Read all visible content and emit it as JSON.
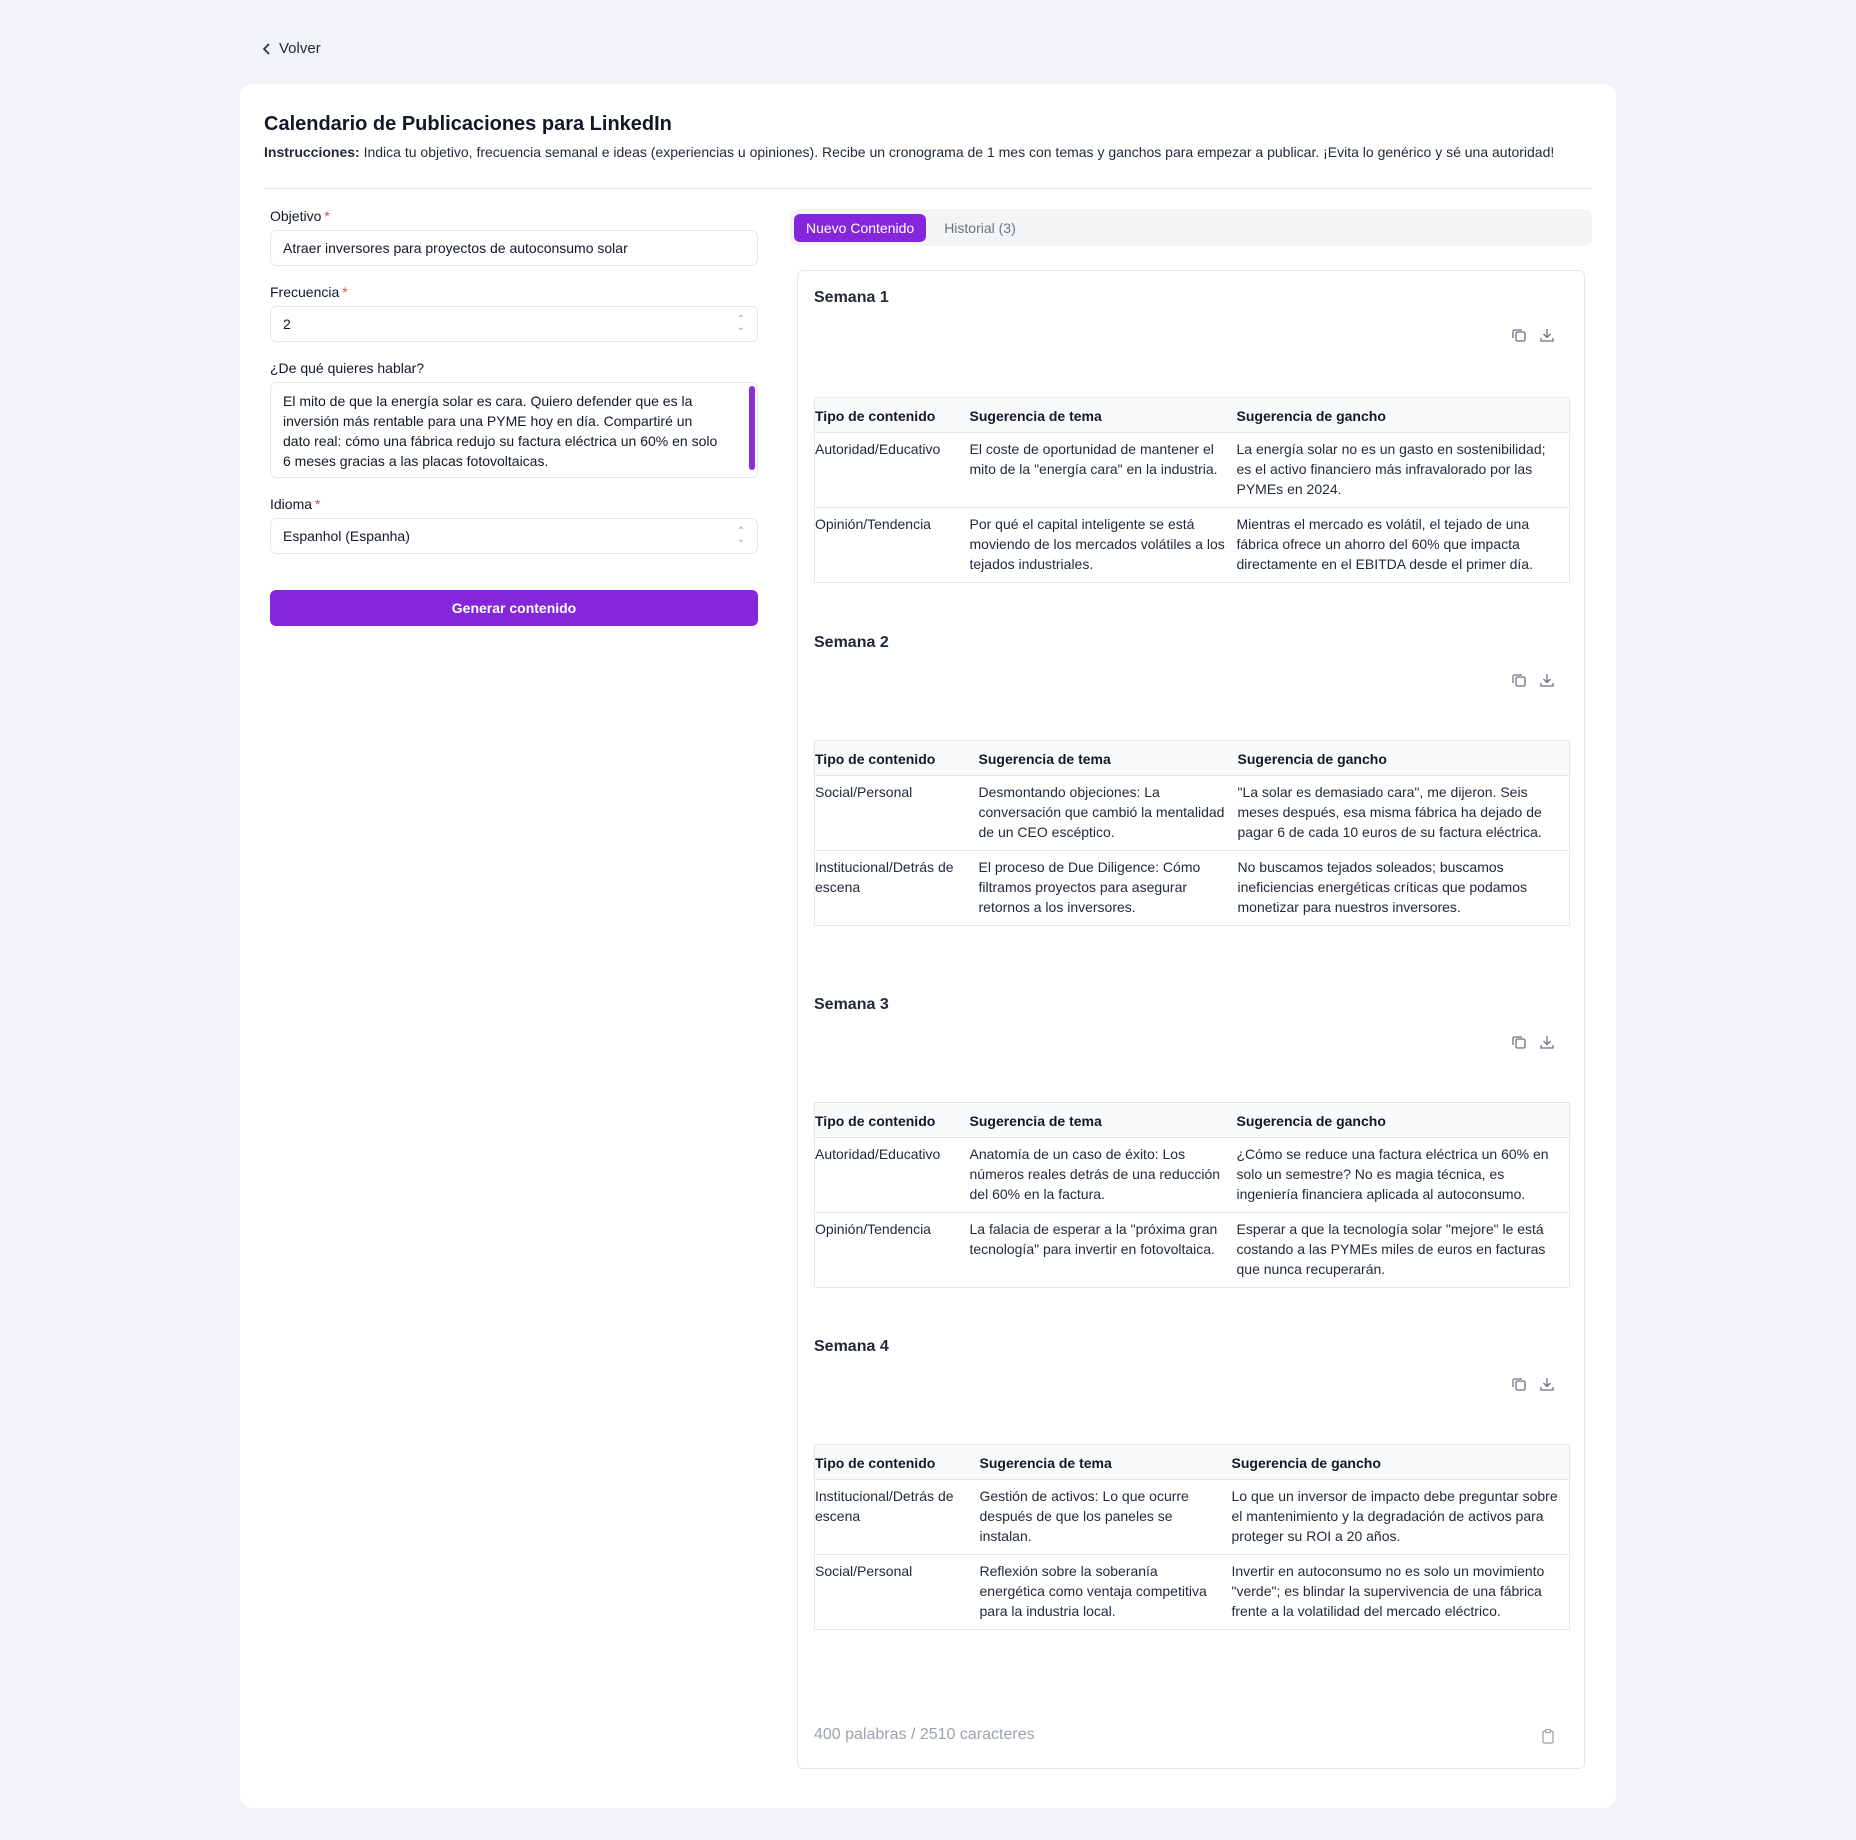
{
  "nav": {
    "back_label": "Volver"
  },
  "page": {
    "title": "Calendario de Publicaciones para LinkedIn",
    "instructions_label": "Instrucciones:",
    "instructions_text": " Indica tu objetivo, frecuencia semanal e ideas (experiencias u opiniones). Recibe un cronograma de 1 mes con temas y ganchos para empezar a publicar. ¡Evita lo genérico y sé una autoridad!"
  },
  "form": {
    "objetivo_label": "Objetivo",
    "objetivo_value": "Atraer inversores para proyectos de autoconsumo solar",
    "frecuencia_label": "Frecuencia",
    "frecuencia_value": "2",
    "tema_label": "¿De qué quieres hablar?",
    "tema_value": "El mito de que la energía solar es cara. Quiero defender que es la inversión más rentable para una PYME hoy en día. Compartiré un dato real: cómo una fábrica redujo su factura eléctrica un 60% en solo 6 meses gracias a las placas fotovoltaicas.",
    "idioma_label": "Idioma",
    "idioma_value": "Espanhol (Espanha)",
    "required_mark": "*",
    "generate_label": "Generar contenido"
  },
  "tabs": [
    {
      "label": "Nuevo Contenido",
      "active": true
    },
    {
      "label": "Historial (3)",
      "active": false
    }
  ],
  "columns": [
    "Tipo de contenido",
    "Sugerencia de tema",
    "Sugerencia de gancho"
  ],
  "weeks": [
    {
      "title": "Semana 1",
      "rows": [
        {
          "tipo": "Autoridad/Educativo",
          "tema": "El coste de oportunidad de mantener el mito de la \"energía cara\" en la industria.",
          "gancho": "La energía solar no es un gasto en sostenibilidad; es el activo financiero más infravalorado por las PYMEs en 2024."
        },
        {
          "tipo": "Opinión/Tendencia",
          "tema": "Por qué el capital inteligente se está moviendo de los mercados volátiles a los tejados industriales.",
          "gancho": "Mientras el mercado es volátil, el tejado de una fábrica ofrece un ahorro del 60% que impacta directamente en el EBITDA desde el primer día."
        }
      ]
    },
    {
      "title": "Semana 2",
      "rows": [
        {
          "tipo": "Social/Personal",
          "tema": "Desmontando objeciones: La conversación que cambió la mentalidad de un CEO escéptico.",
          "gancho": "\"La solar es demasiado cara\", me dijeron. Seis meses después, esa misma fábrica ha dejado de pagar 6 de cada 10 euros de su factura eléctrica."
        },
        {
          "tipo": "Institucional/Detrás de escena",
          "tema": "El proceso de Due Diligence: Cómo filtramos proyectos para asegurar retornos a los inversores.",
          "gancho": "No buscamos tejados soleados; buscamos ineficiencias energéticas críticas que podamos monetizar para nuestros inversores."
        }
      ]
    },
    {
      "title": "Semana 3",
      "rows": [
        {
          "tipo": "Autoridad/Educativo",
          "tema": "Anatomía de un caso de éxito: Los números reales detrás de una reducción del 60% en la factura.",
          "gancho": "¿Cómo se reduce una factura eléctrica un 60% en solo un semestre? No es magia técnica, es ingeniería financiera aplicada al autoconsumo."
        },
        {
          "tipo": "Opinión/Tendencia",
          "tema": "La falacia de esperar a la \"próxima gran tecnología\" para invertir en fotovoltaica.",
          "gancho": "Esperar a que la tecnología solar \"mejore\" le está costando a las PYMEs miles de euros en facturas que nunca recuperarán."
        }
      ]
    },
    {
      "title": "Semana 4",
      "rows": [
        {
          "tipo": "Institucional/Detrás de escena",
          "tema": "Gestión de activos: Lo que ocurre después de que los paneles se instalan.",
          "gancho": "Lo que un inversor de impacto debe preguntar sobre el mantenimiento y la degradación de activos para proteger su ROI a 20 años."
        },
        {
          "tipo": "Social/Personal",
          "tema": "Reflexión sobre la soberanía energética como ventaja competitiva para la industria local.",
          "gancho": "Invertir en autoconsumo no es solo un movimiento \"verde\"; es blindar la supervivencia de una fábrica frente a la volatilidad del mercado eléctrico."
        }
      ]
    }
  ],
  "footer": {
    "count": "400 palabras / 2510 caracteres"
  },
  "icons": {
    "back": "chevron-left-icon",
    "copy": "copy-icon",
    "download": "download-icon",
    "clipboard": "clipboard-icon"
  },
  "colors": {
    "accent": "#8526dc",
    "background": "#f1f3f7"
  }
}
